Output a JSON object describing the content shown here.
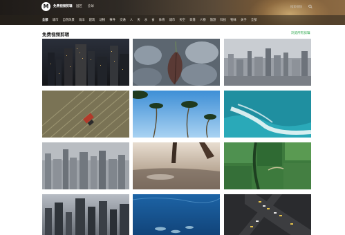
{
  "header": {
    "logo_letter": "M",
    "site_name": "免费视频剪辑",
    "nav": [
      "国区",
      "全球"
    ],
    "search_placeholder": "搜索视频"
  },
  "categories": [
    "全部",
    "城市",
    "自然风景",
    "海洋",
    "建筑",
    "动物",
    "事件",
    "交通",
    "人",
    "天",
    "水",
    "食",
    "体育",
    "城市",
    "天空",
    "日落",
    "人物",
    "旅游",
    "科技",
    "物体",
    "关于",
    "全部"
  ],
  "section": {
    "title": "免费视频剪辑",
    "view_all": "浏览所有剪辑"
  },
  "clips": [
    {
      "name": "city-night-aerial"
    },
    {
      "name": "frosty-leaves-closeup"
    },
    {
      "name": "city-skyline-haze"
    },
    {
      "name": "tractor-field-aerial"
    },
    {
      "name": "palm-trees-sky"
    },
    {
      "name": "ocean-wave-aerial"
    },
    {
      "name": "dense-city-skyline"
    },
    {
      "name": "shoreline-footprints"
    },
    {
      "name": "green-farmland-aerial"
    },
    {
      "name": "night-city-towers"
    },
    {
      "name": "underwater-fish"
    },
    {
      "name": "traffic-intersection-aerial"
    }
  ],
  "colors": {
    "accent_green": "#2fa84f",
    "header_dark": "#1f1b18"
  }
}
